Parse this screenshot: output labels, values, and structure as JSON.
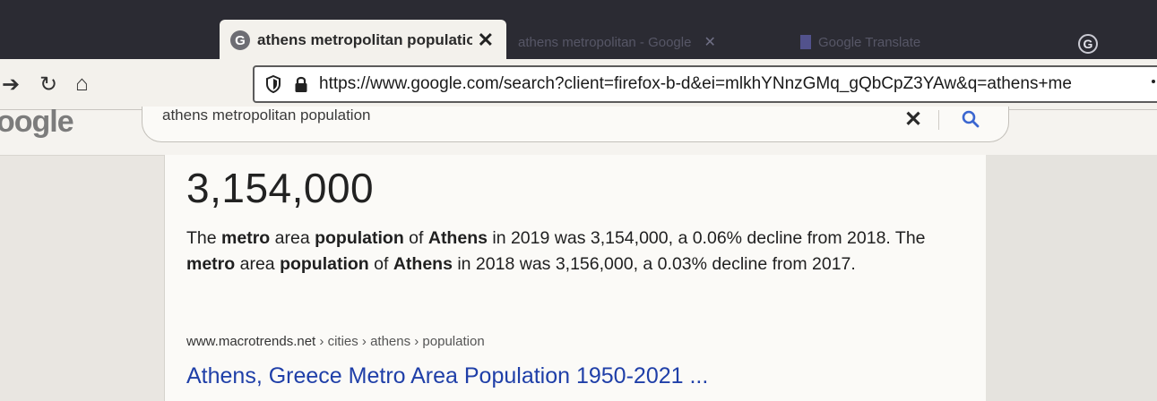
{
  "browser": {
    "tabs": [
      {
        "favicon": "G",
        "title": "athens metropolitan populatior",
        "close": "✕",
        "active": true
      },
      {
        "title": "athens metropolitan - Google",
        "close": "✕",
        "active": false
      },
      {
        "title": "Google Translate",
        "active": false
      }
    ],
    "extension_icon": "G",
    "url": "https://www.google.com/search?client=firefox-b-d&ei=mlkhYNnzGMq_gQbCpZ3YAw&q=athens+me"
  },
  "google": {
    "logo_text": "oogle",
    "query": "athens metropolitan population",
    "clear_symbol": "✕"
  },
  "featured": {
    "value": "3,154,000",
    "snippet": [
      {
        "t": "The ",
        "b": false
      },
      {
        "t": "metro",
        "b": true
      },
      {
        "t": " area ",
        "b": false
      },
      {
        "t": "population",
        "b": true
      },
      {
        "t": " of ",
        "b": false
      },
      {
        "t": "Athens",
        "b": true
      },
      {
        "t": " in 2019 was 3,154,000, a 0.06% decline from 2018. The ",
        "b": false
      },
      {
        "t": "metro",
        "b": true
      },
      {
        "t": " area ",
        "b": false
      },
      {
        "t": "population",
        "b": true
      },
      {
        "t": " of ",
        "b": false
      },
      {
        "t": "Athens",
        "b": true
      },
      {
        "t": " in 2018 was 3,156,000, a 0.03% decline from 2017.",
        "b": false
      }
    ],
    "source_domain": "www.macrotrends.net",
    "source_path": " › cities › athens › population",
    "link_title": "Athens, Greece Metro Area Population 1950-2021 ..."
  },
  "colors": {
    "link": "#1f3fa8",
    "tabstrip": "#2b2b33"
  }
}
